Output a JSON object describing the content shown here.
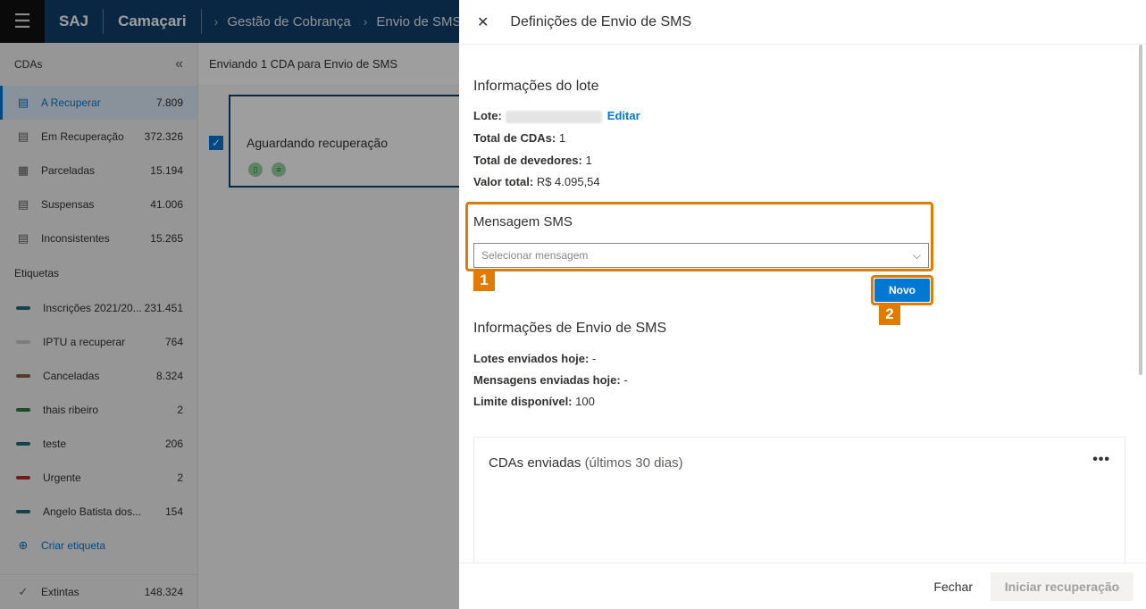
{
  "topbar": {
    "brand": "SAJ",
    "org": "Camaçari",
    "breadcrumbs": [
      "Gestão de Cobrança",
      "Envio de SMS"
    ]
  },
  "sidebar": {
    "title": "CDAs",
    "items": [
      {
        "label": "A Recuperar",
        "count": "7.809",
        "icon": "document-dollar-icon"
      },
      {
        "label": "Em Recuperação",
        "count": "372.326",
        "icon": "document-refresh-icon"
      },
      {
        "label": "Parceladas",
        "count": "15.194",
        "icon": "calendar-dollar-icon"
      },
      {
        "label": "Suspensas",
        "count": "41.006",
        "icon": "document-pause-icon"
      },
      {
        "label": "Inconsistentes",
        "count": "15.265",
        "icon": "document-clock-icon"
      }
    ],
    "tags_title": "Etiquetas",
    "tags": [
      {
        "label": "Inscrições 2021/20...",
        "count": "231.451",
        "color": "#1f6f7a"
      },
      {
        "label": "IPTU a recuperar",
        "count": "764",
        "color": "#c8c8c8"
      },
      {
        "label": "Canceladas",
        "count": "8.324",
        "color": "#8b5e4e"
      },
      {
        "label": "thais ribeiro",
        "count": "2",
        "color": "#2e7d32"
      },
      {
        "label": "teste",
        "count": "206",
        "color": "#1f6f7a"
      },
      {
        "label": "Urgente",
        "count": "2",
        "color": "#c62828"
      },
      {
        "label": "Angelo Batista dos...",
        "count": "154",
        "color": "#1f6f7a"
      }
    ],
    "create_tag": "Criar etiqueta",
    "footer": {
      "label": "Extintas",
      "count": "148.324"
    }
  },
  "main": {
    "header": "Enviando 1 CDA para  Envio de SMS",
    "card_title": "Aguardando recuperação"
  },
  "panel": {
    "title": "Definições de Envio de SMS",
    "lote_section": "Informações do lote",
    "lote_label": "Lote:",
    "edit_link": "Editar",
    "total_cdas_label": "Total de CDAs:",
    "total_cdas_value": "1",
    "total_devedores_label": "Total de devedores:",
    "total_devedores_value": "1",
    "valor_total_label": "Valor total:",
    "valor_total_value": "R$ 4.095,54",
    "sms_section": "Mensagem SMS",
    "select_placeholder": "Selecionar mensagem",
    "badge1": "1",
    "novo_button": "Novo",
    "badge2": "2",
    "envio_section": "Informações de Envio de SMS",
    "lotes_hoje_label": "Lotes enviados hoje:",
    "lotes_hoje_value": "-",
    "mensagens_hoje_label": "Mensagens enviadas hoje:",
    "mensagens_hoje_value": "-",
    "limite_label": "Limite disponível:",
    "limite_value": "100",
    "cdas_enviadas_title": "CDAs enviadas",
    "cdas_enviadas_sub": "(últimos 30 dias)",
    "more": "•••",
    "close_button": "Fechar",
    "start_button": "Iniciar recuperação"
  },
  "colors": {
    "accent": "#0078d4",
    "topbar": "#0f3e6b",
    "highlight": "#e07b00"
  }
}
